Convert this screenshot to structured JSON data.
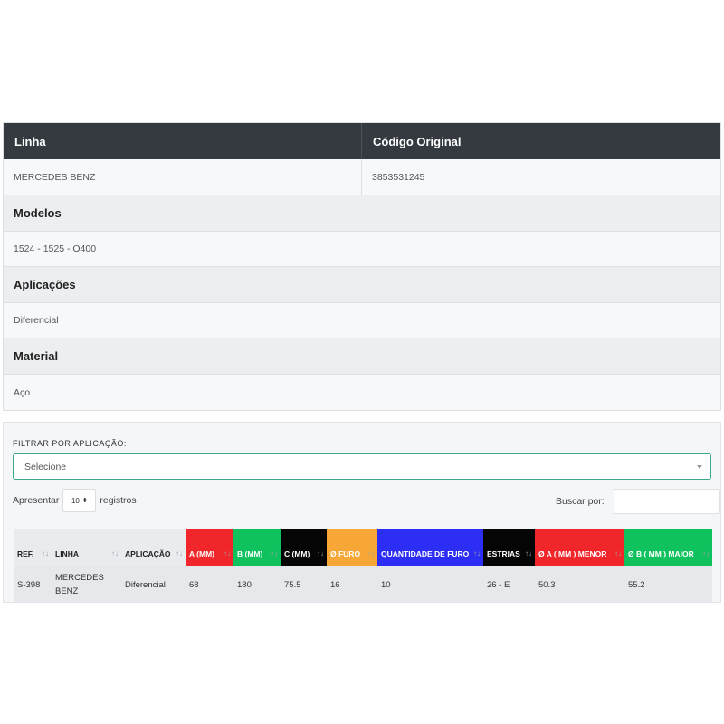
{
  "info": {
    "headers": {
      "linha": "Linha",
      "codigo": "Código Original"
    },
    "values": {
      "linha": "MERCEDES BENZ",
      "codigo": "3853531245"
    },
    "sections": [
      {
        "title": "Modelos",
        "value": "1524 - 1525 - O400"
      },
      {
        "title": "Aplicações",
        "value": "Diferencial"
      },
      {
        "title": "Material",
        "value": "Aço"
      }
    ]
  },
  "filter": {
    "label": "FILTRAR POR APLICAÇÃO:",
    "selected": "Selecione"
  },
  "length": {
    "prefix": "Apresentar",
    "value": "10",
    "suffix": "registros"
  },
  "search": {
    "label": "Buscar por:",
    "value": ""
  },
  "table": {
    "columns": [
      "REF.",
      "LINHA",
      "APLICAÇÃO",
      "A (MM)",
      "B (MM)",
      "C (MM)",
      "Ø FURO",
      "QUANTIDADE DE FURO",
      "ESTRIAS",
      "Ø A ( MM ) MENOR",
      "Ø B ( MM ) MAIOR"
    ],
    "column_colors": {
      "A (MM)": "#f0262b",
      "B (MM)": "#0fc25d",
      "C (MM)": "#050505",
      "Ø FURO": "#f7a735",
      "QUANTIDADE DE FURO": "#2d2ef5",
      "ESTRIAS": "#050505",
      "Ø A ( MM ) MENOR": "#f0262b",
      "Ø B ( MM ) MAIOR": "#0fc25d"
    },
    "rows": [
      [
        "S-398",
        "MERCEDES BENZ",
        "Diferencial",
        "68",
        "180",
        "75.5",
        "16",
        "10",
        "26 - E",
        "50.3",
        "55.2"
      ]
    ]
  }
}
